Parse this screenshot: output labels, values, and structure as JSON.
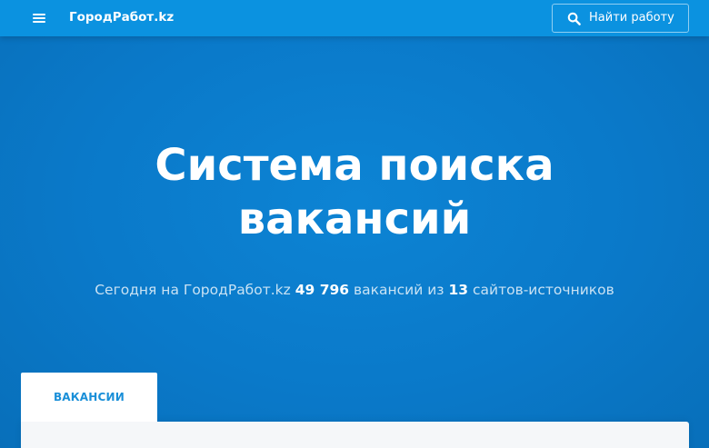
{
  "header": {
    "logo": "ГородРабот.kz",
    "find_button_label": "Найти работу",
    "menu_icon": "hamburger-menu-icon",
    "search_icon": "search-icon"
  },
  "hero": {
    "title_line1": "Система поиска",
    "title_line2": "вакансий",
    "subtitle_prefix": "Сегодня на ГородРабот.kz ",
    "vacancy_count": "49 796",
    "subtitle_middle": " вакансий из ",
    "source_count": "13",
    "subtitle_suffix": " сайтов-источников"
  },
  "tabs": [
    {
      "label": "ВАКАНСИИ",
      "active": true
    }
  ],
  "colors": {
    "header_bg": "#0b92e0",
    "hero_bg": "#0a77c8",
    "tab_label": "#1a8fd8",
    "panel_bg": "#f5f7f9"
  }
}
